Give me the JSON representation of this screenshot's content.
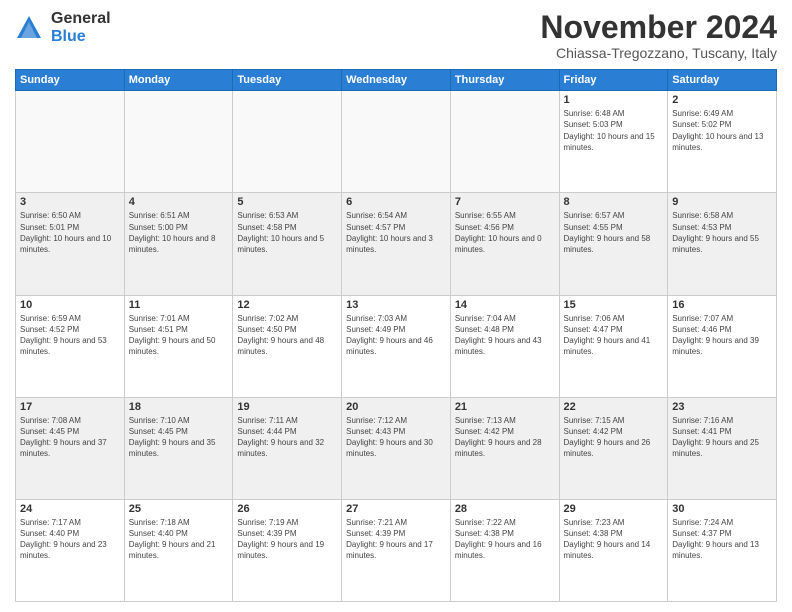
{
  "logo": {
    "line1": "General",
    "line2": "Blue"
  },
  "title": "November 2024",
  "subtitle": "Chiassa-Tregozzano, Tuscany, Italy",
  "days_header": [
    "Sunday",
    "Monday",
    "Tuesday",
    "Wednesday",
    "Thursday",
    "Friday",
    "Saturday"
  ],
  "weeks": [
    [
      {
        "day": "",
        "info": ""
      },
      {
        "day": "",
        "info": ""
      },
      {
        "day": "",
        "info": ""
      },
      {
        "day": "",
        "info": ""
      },
      {
        "day": "",
        "info": ""
      },
      {
        "day": "1",
        "info": "Sunrise: 6:48 AM\nSunset: 5:03 PM\nDaylight: 10 hours and 15 minutes."
      },
      {
        "day": "2",
        "info": "Sunrise: 6:49 AM\nSunset: 5:02 PM\nDaylight: 10 hours and 13 minutes."
      }
    ],
    [
      {
        "day": "3",
        "info": "Sunrise: 6:50 AM\nSunset: 5:01 PM\nDaylight: 10 hours and 10 minutes."
      },
      {
        "day": "4",
        "info": "Sunrise: 6:51 AM\nSunset: 5:00 PM\nDaylight: 10 hours and 8 minutes."
      },
      {
        "day": "5",
        "info": "Sunrise: 6:53 AM\nSunset: 4:58 PM\nDaylight: 10 hours and 5 minutes."
      },
      {
        "day": "6",
        "info": "Sunrise: 6:54 AM\nSunset: 4:57 PM\nDaylight: 10 hours and 3 minutes."
      },
      {
        "day": "7",
        "info": "Sunrise: 6:55 AM\nSunset: 4:56 PM\nDaylight: 10 hours and 0 minutes."
      },
      {
        "day": "8",
        "info": "Sunrise: 6:57 AM\nSunset: 4:55 PM\nDaylight: 9 hours and 58 minutes."
      },
      {
        "day": "9",
        "info": "Sunrise: 6:58 AM\nSunset: 4:53 PM\nDaylight: 9 hours and 55 minutes."
      }
    ],
    [
      {
        "day": "10",
        "info": "Sunrise: 6:59 AM\nSunset: 4:52 PM\nDaylight: 9 hours and 53 minutes."
      },
      {
        "day": "11",
        "info": "Sunrise: 7:01 AM\nSunset: 4:51 PM\nDaylight: 9 hours and 50 minutes."
      },
      {
        "day": "12",
        "info": "Sunrise: 7:02 AM\nSunset: 4:50 PM\nDaylight: 9 hours and 48 minutes."
      },
      {
        "day": "13",
        "info": "Sunrise: 7:03 AM\nSunset: 4:49 PM\nDaylight: 9 hours and 46 minutes."
      },
      {
        "day": "14",
        "info": "Sunrise: 7:04 AM\nSunset: 4:48 PM\nDaylight: 9 hours and 43 minutes."
      },
      {
        "day": "15",
        "info": "Sunrise: 7:06 AM\nSunset: 4:47 PM\nDaylight: 9 hours and 41 minutes."
      },
      {
        "day": "16",
        "info": "Sunrise: 7:07 AM\nSunset: 4:46 PM\nDaylight: 9 hours and 39 minutes."
      }
    ],
    [
      {
        "day": "17",
        "info": "Sunrise: 7:08 AM\nSunset: 4:45 PM\nDaylight: 9 hours and 37 minutes."
      },
      {
        "day": "18",
        "info": "Sunrise: 7:10 AM\nSunset: 4:45 PM\nDaylight: 9 hours and 35 minutes."
      },
      {
        "day": "19",
        "info": "Sunrise: 7:11 AM\nSunset: 4:44 PM\nDaylight: 9 hours and 32 minutes."
      },
      {
        "day": "20",
        "info": "Sunrise: 7:12 AM\nSunset: 4:43 PM\nDaylight: 9 hours and 30 minutes."
      },
      {
        "day": "21",
        "info": "Sunrise: 7:13 AM\nSunset: 4:42 PM\nDaylight: 9 hours and 28 minutes."
      },
      {
        "day": "22",
        "info": "Sunrise: 7:15 AM\nSunset: 4:42 PM\nDaylight: 9 hours and 26 minutes."
      },
      {
        "day": "23",
        "info": "Sunrise: 7:16 AM\nSunset: 4:41 PM\nDaylight: 9 hours and 25 minutes."
      }
    ],
    [
      {
        "day": "24",
        "info": "Sunrise: 7:17 AM\nSunset: 4:40 PM\nDaylight: 9 hours and 23 minutes."
      },
      {
        "day": "25",
        "info": "Sunrise: 7:18 AM\nSunset: 4:40 PM\nDaylight: 9 hours and 21 minutes."
      },
      {
        "day": "26",
        "info": "Sunrise: 7:19 AM\nSunset: 4:39 PM\nDaylight: 9 hours and 19 minutes."
      },
      {
        "day": "27",
        "info": "Sunrise: 7:21 AM\nSunset: 4:39 PM\nDaylight: 9 hours and 17 minutes."
      },
      {
        "day": "28",
        "info": "Sunrise: 7:22 AM\nSunset: 4:38 PM\nDaylight: 9 hours and 16 minutes."
      },
      {
        "day": "29",
        "info": "Sunrise: 7:23 AM\nSunset: 4:38 PM\nDaylight: 9 hours and 14 minutes."
      },
      {
        "day": "30",
        "info": "Sunrise: 7:24 AM\nSunset: 4:37 PM\nDaylight: 9 hours and 13 minutes."
      }
    ]
  ]
}
